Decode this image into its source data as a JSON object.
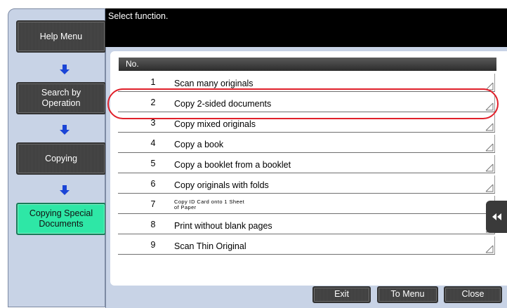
{
  "header": {
    "prompt": "Select function."
  },
  "nav": {
    "help_menu": "Help Menu",
    "search_by_operation": "Search by\nOperation",
    "copying": "Copying",
    "copying_special": "Copying Special\nDocuments"
  },
  "list": {
    "column_header": "No.",
    "rows": [
      {
        "num": "1",
        "label": "Scan many originals"
      },
      {
        "num": "2",
        "label": "Copy 2-sided documents"
      },
      {
        "num": "3",
        "label": "Copy mixed originals"
      },
      {
        "num": "4",
        "label": "Copy a book"
      },
      {
        "num": "5",
        "label": "Copy a booklet from a booklet"
      },
      {
        "num": "6",
        "label": "Copy originals with folds"
      },
      {
        "num": "7",
        "label": "Copy ID Card onto 1 Sheet\nof Paper"
      },
      {
        "num": "8",
        "label": "Print without blank pages"
      },
      {
        "num": "9",
        "label": "Scan Thin Original"
      }
    ]
  },
  "footer": {
    "exit": "Exit",
    "to_menu": "To Menu",
    "close": "Close"
  },
  "icons": {
    "nav_arrow": "arrow-down-icon",
    "side_tab": "double-chevron-left-icon",
    "row_corner": "corner-triangle-icon"
  },
  "colors": {
    "active_nav": "#2ee7a6",
    "highlight": "#e0202a",
    "panel_bg": "#c8d3e6"
  }
}
